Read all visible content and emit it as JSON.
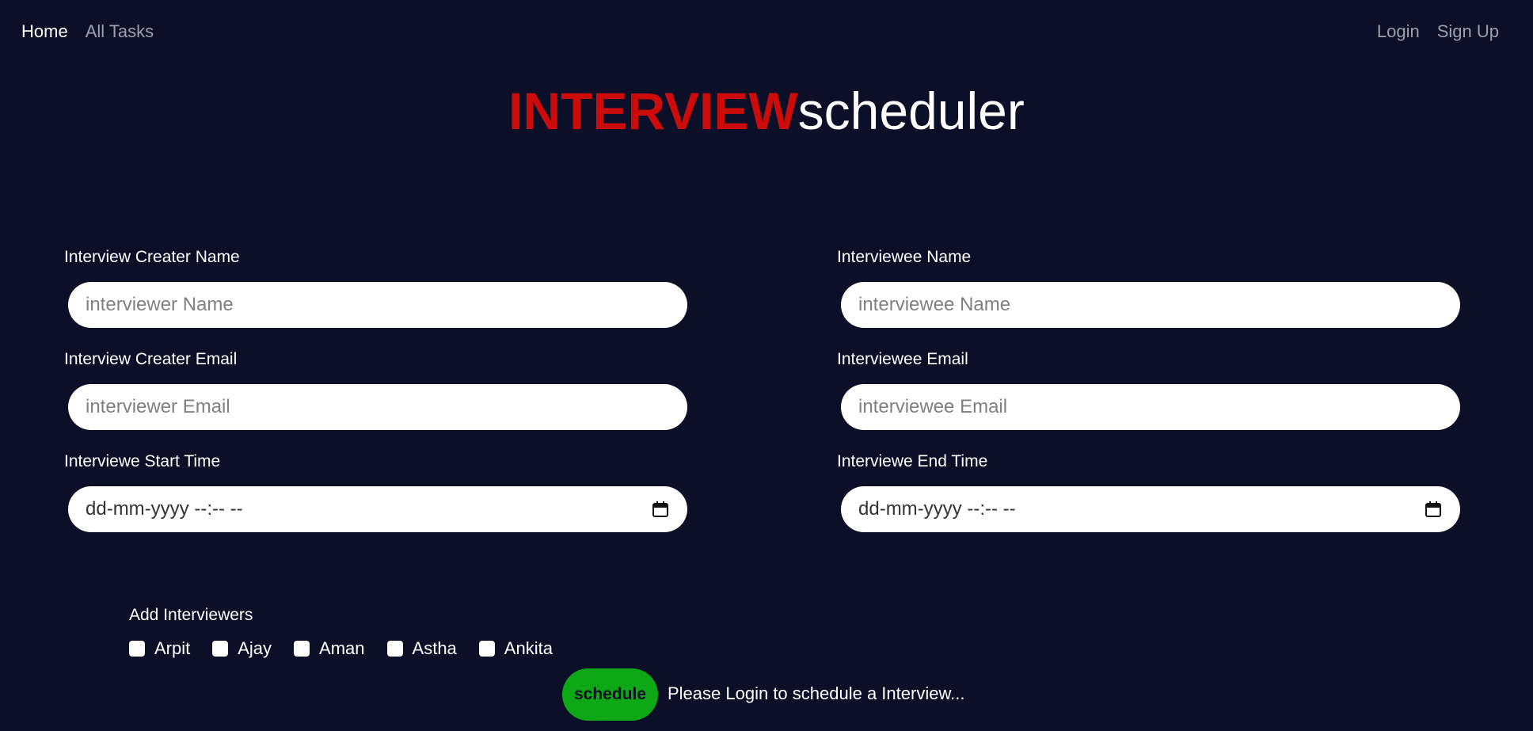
{
  "nav": {
    "left": [
      {
        "label": "Home",
        "active": true
      },
      {
        "label": "All Tasks",
        "active": false
      }
    ],
    "right": [
      {
        "label": "Login"
      },
      {
        "label": "Sign Up"
      }
    ]
  },
  "brand": {
    "bold_part": "INTERVIEW",
    "light_part": "scheduler",
    "bold_color": "#cc0b0b"
  },
  "form": {
    "creator_name": {
      "label": "Interview Creater Name",
      "placeholder": "interviewer Name",
      "value": ""
    },
    "creator_email": {
      "label": "Interview Creater Email",
      "placeholder": "interviewer Email",
      "value": ""
    },
    "start_time": {
      "label": "Interviewe Start Time",
      "value": "dd-mm-yyyy --:-- --",
      "icon": "calendar-icon"
    },
    "interviewee_name": {
      "label": "Interviewee Name",
      "placeholder": "interviewee Name",
      "value": ""
    },
    "interviewee_email": {
      "label": "Interviewee Email",
      "placeholder": "interviewee Email",
      "value": ""
    },
    "end_time": {
      "label": "Interviewe End Time",
      "value": "dd-mm-yyyy --:-- --",
      "icon": "calendar-icon"
    }
  },
  "interviewers": {
    "title": "Add Interviewers",
    "options": [
      {
        "label": "Arpit",
        "checked": false
      },
      {
        "label": "Ajay",
        "checked": false
      },
      {
        "label": "Aman",
        "checked": false
      },
      {
        "label": "Astha",
        "checked": false
      },
      {
        "label": "Ankita",
        "checked": false
      }
    ]
  },
  "actions": {
    "schedule_label": "schedule",
    "schedule_color": "#0ea817",
    "status_message": "Please Login to schedule a Interview..."
  },
  "colors": {
    "background": "#0b1028",
    "nav_inactive": "#9aa0ad"
  }
}
